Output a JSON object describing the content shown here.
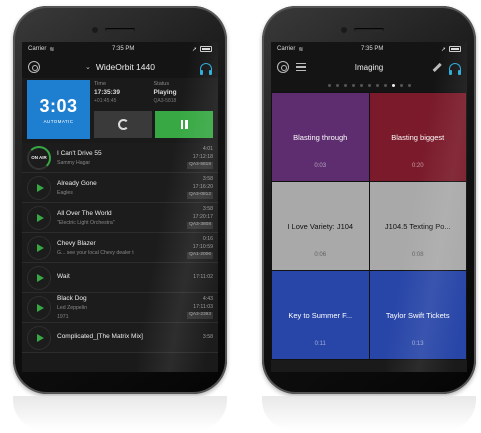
{
  "status": {
    "carrier": "Carrier",
    "time": "7:35 PM"
  },
  "left": {
    "nav_title": "WideOrbit 1440",
    "clock": {
      "value": "3:03",
      "mode": "AUTOMATIC"
    },
    "time_col": {
      "label": "Time",
      "value": "17:35:39",
      "sub": "+01:45:45"
    },
    "status_col": {
      "label": "Status",
      "value": "Playing",
      "sub": "QA3-5818"
    },
    "rows": [
      {
        "kind": "onair",
        "lead": "ON AIR",
        "title": "I Can't Drive 55",
        "artist": "Sammy Hagar",
        "dur": "4:01",
        "time": "17:12:18",
        "code": "QA3-5818"
      },
      {
        "kind": "play",
        "title": "Already Gone",
        "artist": "Eagles",
        "dur": "3:58",
        "time": "17:16:20",
        "code": "QA3-0812"
      },
      {
        "kind": "play",
        "title": "All Over The World",
        "artist": "\"Electric Light Orchestra\"",
        "dur": "3:58",
        "time": "17:20:17",
        "code": "QA3-3808"
      },
      {
        "kind": "play",
        "title": "Chevy Blazer",
        "artist": "G... see your local Chevy dealer t",
        "dur": "0:16",
        "time": "17:10:59",
        "code": "QA1-2006"
      },
      {
        "kind": "play",
        "title": "Wait",
        "artist": "",
        "dur": "",
        "time": "17:11:02",
        "code": ""
      },
      {
        "kind": "play",
        "title": "Black Dog",
        "artist": "Led Zeppelin",
        "dur": "4:43",
        "time": "17:11:03",
        "code": "QA3-2393",
        "extra": "1971"
      },
      {
        "kind": "play",
        "title": "Complicated_[The Matrix Mix]",
        "artist": "",
        "dur": "3:58",
        "time": "",
        "code": ""
      }
    ]
  },
  "right": {
    "nav_title": "Imaging",
    "dots_count": 11,
    "active_dot": 8,
    "tiles": [
      {
        "label": "Blasting through",
        "dur": "0:03",
        "color": "#5e2d6f",
        "dark": false
      },
      {
        "label": "Blasting biggest",
        "dur": "0:20",
        "color": "#7a1a2a",
        "dark": false
      },
      {
        "label": "I Love Variety: J104",
        "dur": "0:06",
        "color": "#a9a9a9",
        "dark": true
      },
      {
        "label": "J104.5 Texting Po...",
        "dur": "0:08",
        "color": "#a9a9a9",
        "dark": true
      },
      {
        "label": "Key to Summer F...",
        "dur": "0:11",
        "color": "#2846a8",
        "dark": false
      },
      {
        "label": "Taylor Swift Tickets",
        "dur": "0:13",
        "color": "#2846a8",
        "dark": false
      }
    ]
  },
  "colors": {
    "accent_green": "#37a843",
    "accent_blue": "#1e7fd0",
    "headphones": "#2aa9d8"
  }
}
